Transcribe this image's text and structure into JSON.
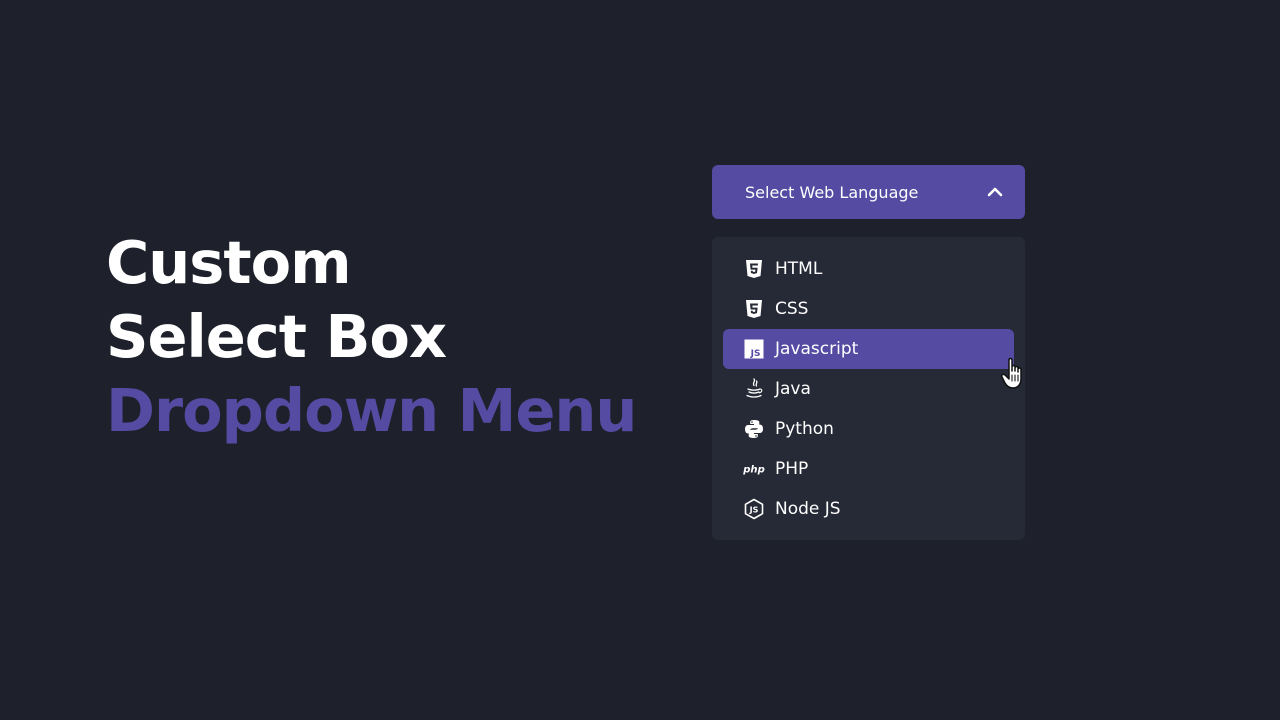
{
  "hero": {
    "line1": "Custom",
    "line2": "Select Box",
    "line3": "Dropdown Menu"
  },
  "select": {
    "button_label": "Select Web Language",
    "chevron_icon": "chevron-up-icon",
    "options": [
      {
        "label": "HTML",
        "icon": "html5-icon"
      },
      {
        "label": "CSS",
        "icon": "css3-icon"
      },
      {
        "label": "Javascript",
        "icon": "js-icon",
        "selected": true
      },
      {
        "label": "Java",
        "icon": "java-icon"
      },
      {
        "label": "Python",
        "icon": "python-icon"
      },
      {
        "label": "PHP",
        "icon": "php-icon"
      },
      {
        "label": "Node JS",
        "icon": "nodejs-icon"
      }
    ]
  },
  "colors": {
    "background": "#1e212b",
    "accent": "#554ba2",
    "menu_background": "#262a36",
    "text": "#ffffff"
  }
}
